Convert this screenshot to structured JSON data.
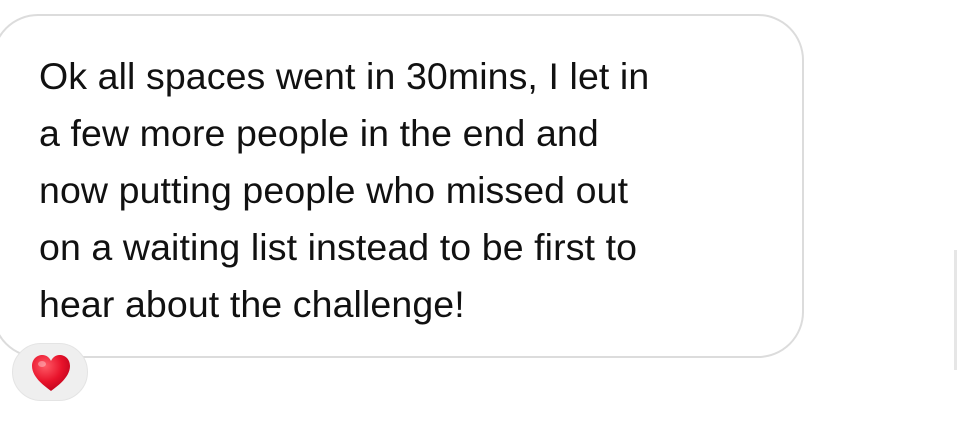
{
  "message": {
    "lines": [
      "Ok all spaces went in 30mins, I let in",
      "a few more people in the end and",
      "now putting people who missed out",
      "on a waiting list instead to be first to",
      "hear about the challenge!"
    ]
  },
  "reaction": {
    "icon": "heart-icon",
    "color": "#e8132b"
  },
  "colors": {
    "bubble_border": "#dcdcdc",
    "text": "#111111",
    "reaction_background": "#efefef"
  }
}
